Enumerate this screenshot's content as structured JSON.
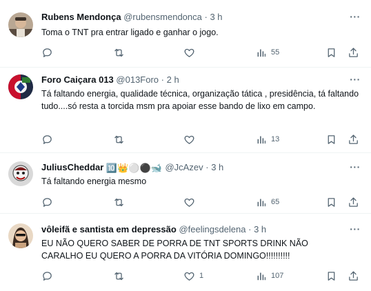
{
  "tweets": [
    {
      "name": "Rubens Mendonça",
      "handle": "@rubensmendonca",
      "time": "3 h",
      "text": "Toma o TNT pra entrar ligado e ganhar o jogo.",
      "replies": "",
      "retweets": "",
      "likes": "",
      "views": "55"
    },
    {
      "name": "Foro Caiçara 013",
      "handle": "@013Foro",
      "time": "2 h",
      "text": "Tá faltando energia, qualidade técnica, organização tática , presidência, tá faltando tudo....só resta a torcida msm pra apoiar esse bando de lixo em campo.",
      "replies": "",
      "retweets": "",
      "likes": "",
      "views": "13"
    },
    {
      "name": "JuliusCheddar",
      "name_emoji": "🔟👑⚪⚫🐋",
      "handle": "@JcAzev",
      "time": "3 h",
      "text": "Tá faltando energia mesmo",
      "replies": "",
      "retweets": "",
      "likes": "",
      "views": "65"
    },
    {
      "name": "vôleifã e santista em depressão",
      "handle": "@feelingsdelena",
      "time": "3 h",
      "text": "EU NÃO QUERO SABER DE PORRA DE TNT SPORTS DRINK NÃO CARALHO EU QUERO A PORRA DA VITÓRIA DOMINGO!!!!!!!!!!",
      "replies": "",
      "retweets": "",
      "likes": "1",
      "views": "107"
    }
  ],
  "separator": "·",
  "more_label": "···",
  "colors": {
    "text": "#0f1419",
    "secondary": "#536471",
    "divider": "#eff3f4",
    "background": "#ffffff"
  }
}
